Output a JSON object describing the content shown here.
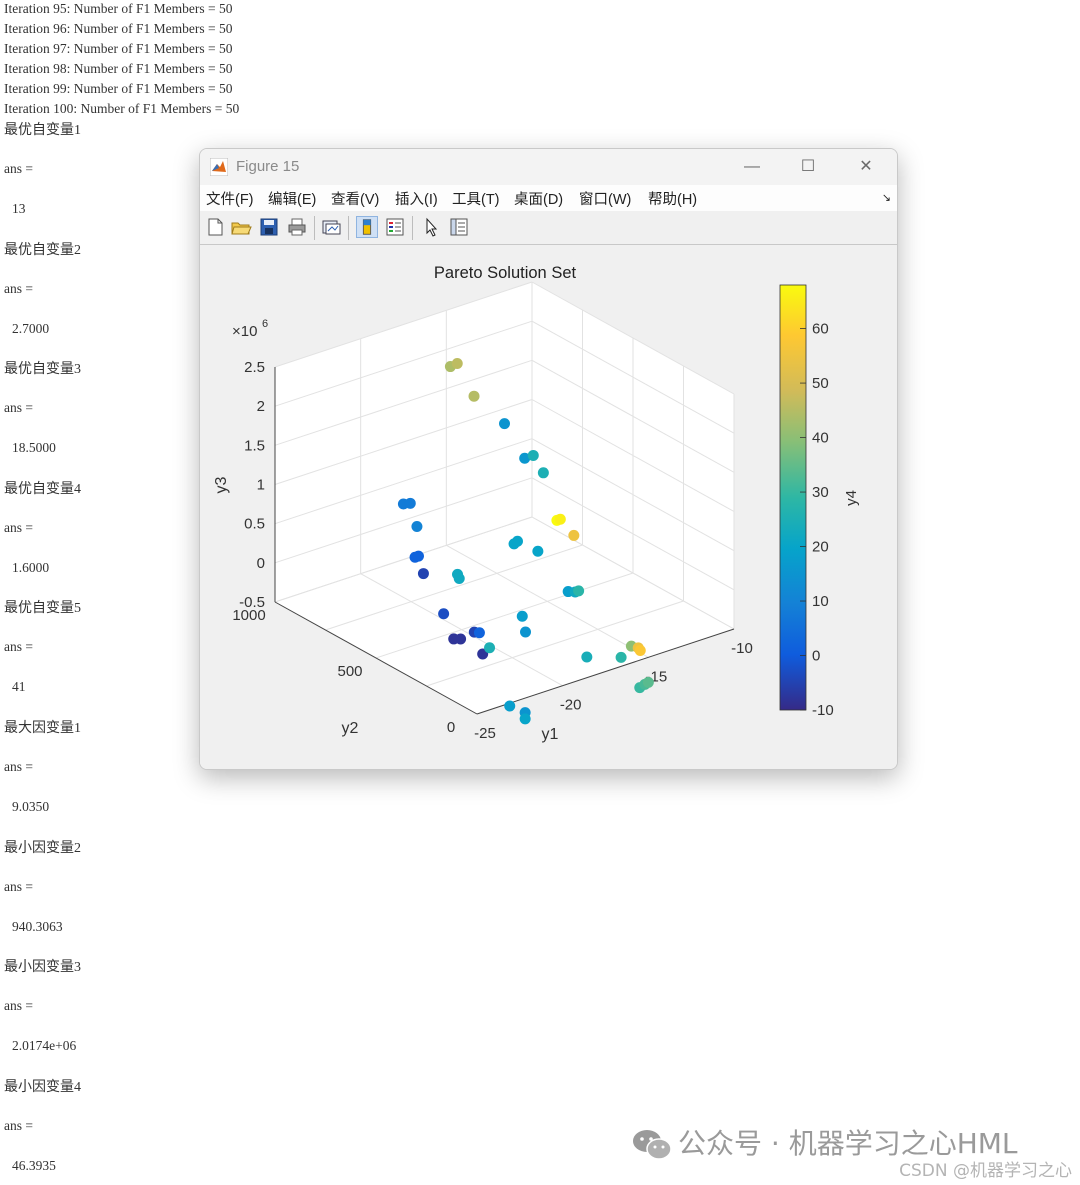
{
  "console": {
    "iterations": [
      "Iteration 95: Number of F1 Members = 50",
      "Iteration 96: Number of F1 Members = 50",
      "Iteration 97: Number of F1 Members = 50",
      "Iteration 98: Number of F1 Members = 50",
      "Iteration 99: Number of F1 Members = 50",
      "Iteration 100: Number of F1 Members = 50"
    ],
    "results": [
      {
        "label": "最优自变量1",
        "ans": "ans =",
        "value": "13"
      },
      {
        "label": "最优自变量2",
        "ans": "ans =",
        "value": "2.7000"
      },
      {
        "label": "最优自变量3",
        "ans": "ans =",
        "value": "18.5000"
      },
      {
        "label": "最优自变量4",
        "ans": "ans =",
        "value": "1.6000"
      },
      {
        "label": "最优自变量5",
        "ans": "ans =",
        "value": "41"
      },
      {
        "label": "最大因变量1",
        "ans": "ans =",
        "value": "9.0350"
      },
      {
        "label": "最小因变量2",
        "ans": "ans =",
        "value": "940.3063"
      },
      {
        "label": "最小因变量3",
        "ans": "ans =",
        "value": "2.0174e+06"
      },
      {
        "label": "最小因变量4",
        "ans": "ans =",
        "value": "46.3935"
      }
    ]
  },
  "figure": {
    "window_title": "Figure 15",
    "menu": [
      "文件(F)",
      "编辑(E)",
      "查看(V)",
      "插入(I)",
      "工具(T)",
      "桌面(D)",
      "窗口(W)",
      "帮助(H)"
    ],
    "window_controls": {
      "minimize": "—",
      "maximize": "☐",
      "close": "✕"
    },
    "toolbar_icons": [
      "new-figure-icon",
      "open-file-icon",
      "save-icon",
      "print-icon",
      "link-plot-icon",
      "colorbar-icon",
      "legend-icon",
      "pointer-icon",
      "property-inspector-icon"
    ]
  },
  "chart_data": {
    "type": "scatter",
    "title": "Pareto Solution Set",
    "xlabel": "y1",
    "ylabel": "y2",
    "zlabel": "y3",
    "z_exponent": "×10^6",
    "colorbar_label": "y4",
    "xlim": [
      -25,
      -10
    ],
    "ylim": [
      0,
      1000
    ],
    "zlim": [
      -0.5,
      2.5
    ],
    "clim": [
      -10,
      68
    ],
    "x_ticks": [
      "-25",
      "-20",
      "-15",
      "-10"
    ],
    "y_ticks": [
      "0",
      "500",
      "1000"
    ],
    "z_ticks": [
      "-0.5",
      "0",
      "0.5",
      "1",
      "1.5",
      "2",
      "2.5"
    ],
    "colorbar_ticks": [
      "-10",
      "0",
      "10",
      "20",
      "30",
      "40",
      "50",
      "60"
    ],
    "grid": true,
    "colormap": "parula",
    "points": [
      {
        "x": -18.3,
        "y": 700,
        "z": 2.45,
        "c": 44
      },
      {
        "x": -17.9,
        "y": 700,
        "z": 2.46,
        "c": 46
      },
      {
        "x": -18.1,
        "y": 600,
        "z": 2.2,
        "c": 45
      },
      {
        "x": -17.5,
        "y": 500,
        "z": 1.95,
        "c": 15
      },
      {
        "x": -17.5,
        "y": 400,
        "z": 1.65,
        "c": 16
      },
      {
        "x": -17.0,
        "y": 400,
        "z": 1.65,
        "c": 25
      },
      {
        "x": -17.0,
        "y": 350,
        "z": 1.5,
        "c": 25
      },
      {
        "x": -23.4,
        "y": 500,
        "z": 1.35,
        "c": 8
      },
      {
        "x": -23.0,
        "y": 500,
        "z": 1.33,
        "c": 8
      },
      {
        "x": -23.2,
        "y": 450,
        "z": 1.12,
        "c": 10
      },
      {
        "x": -23.9,
        "y": 400,
        "z": 0.85,
        "c": 2
      },
      {
        "x": -23.7,
        "y": 400,
        "z": 0.85,
        "c": 2
      },
      {
        "x": -24.0,
        "y": 350,
        "z": 0.72,
        "c": -5
      },
      {
        "x": -22.6,
        "y": 300,
        "z": 0.68,
        "c": 22
      },
      {
        "x": -22.5,
        "y": 300,
        "z": 0.62,
        "c": 22
      },
      {
        "x": -19.3,
        "y": 300,
        "z": 0.83,
        "c": 20
      },
      {
        "x": -19.1,
        "y": 300,
        "z": 0.85,
        "c": 20
      },
      {
        "x": -18.5,
        "y": 250,
        "z": 0.75,
        "c": 20
      },
      {
        "x": -16.8,
        "y": 300,
        "z": 0.95,
        "c": 68
      },
      {
        "x": -16.6,
        "y": 300,
        "z": 0.95,
        "c": 66
      },
      {
        "x": -16.4,
        "y": 250,
        "z": 0.8,
        "c": 55
      },
      {
        "x": -24.0,
        "y": 250,
        "z": 0.35,
        "c": -3
      },
      {
        "x": -24.0,
        "y": 200,
        "z": 0.1,
        "c": -8
      },
      {
        "x": -23.6,
        "y": 200,
        "z": 0.07,
        "c": -8
      },
      {
        "x": -22.8,
        "y": 200,
        "z": 0.1,
        "c": -5
      },
      {
        "x": -22.5,
        "y": 200,
        "z": 0.07,
        "c": 2
      },
      {
        "x": -22.9,
        "y": 150,
        "z": -0.1,
        "c": -8
      },
      {
        "x": -22.5,
        "y": 150,
        "z": -0.05,
        "c": 25
      },
      {
        "x": -20.4,
        "y": 150,
        "z": 0.0,
        "c": 15
      },
      {
        "x": -20.0,
        "y": 200,
        "z": 0.1,
        "c": 18
      },
      {
        "x": -18.5,
        "y": 100,
        "z": 0.45,
        "c": 18
      },
      {
        "x": -17.5,
        "y": 150,
        "z": 0.3,
        "c": 22
      },
      {
        "x": -17.3,
        "y": 150,
        "z": 0.3,
        "c": 28
      },
      {
        "x": -18.0,
        "y": 50,
        "z": -0.35,
        "c": 24
      },
      {
        "x": -22.5,
        "y": 50,
        "z": -0.65,
        "c": 18
      },
      {
        "x": -21.6,
        "y": 50,
        "z": -0.8,
        "c": 15
      },
      {
        "x": -21.6,
        "y": 50,
        "z": -0.88,
        "c": 20
      },
      {
        "x": -16.0,
        "y": 50,
        "z": -0.5,
        "c": 28
      },
      {
        "x": -15.4,
        "y": 50,
        "z": -0.4,
        "c": 40
      },
      {
        "x": -15.0,
        "y": 50,
        "z": -0.45,
        "c": 55
      },
      {
        "x": -15.0,
        "y": 40,
        "z": -0.47,
        "c": 58
      },
      {
        "x": -15.5,
        "y": 0,
        "z": -0.85,
        "c": 30
      },
      {
        "x": -15.2,
        "y": 0,
        "z": -0.83,
        "c": 32
      },
      {
        "x": -15.0,
        "y": 0,
        "z": -0.82,
        "c": 34
      }
    ]
  },
  "watermark": {
    "line1": "公众号 · 机器学习之心HML",
    "line2": "CSDN @机器学习之心"
  }
}
